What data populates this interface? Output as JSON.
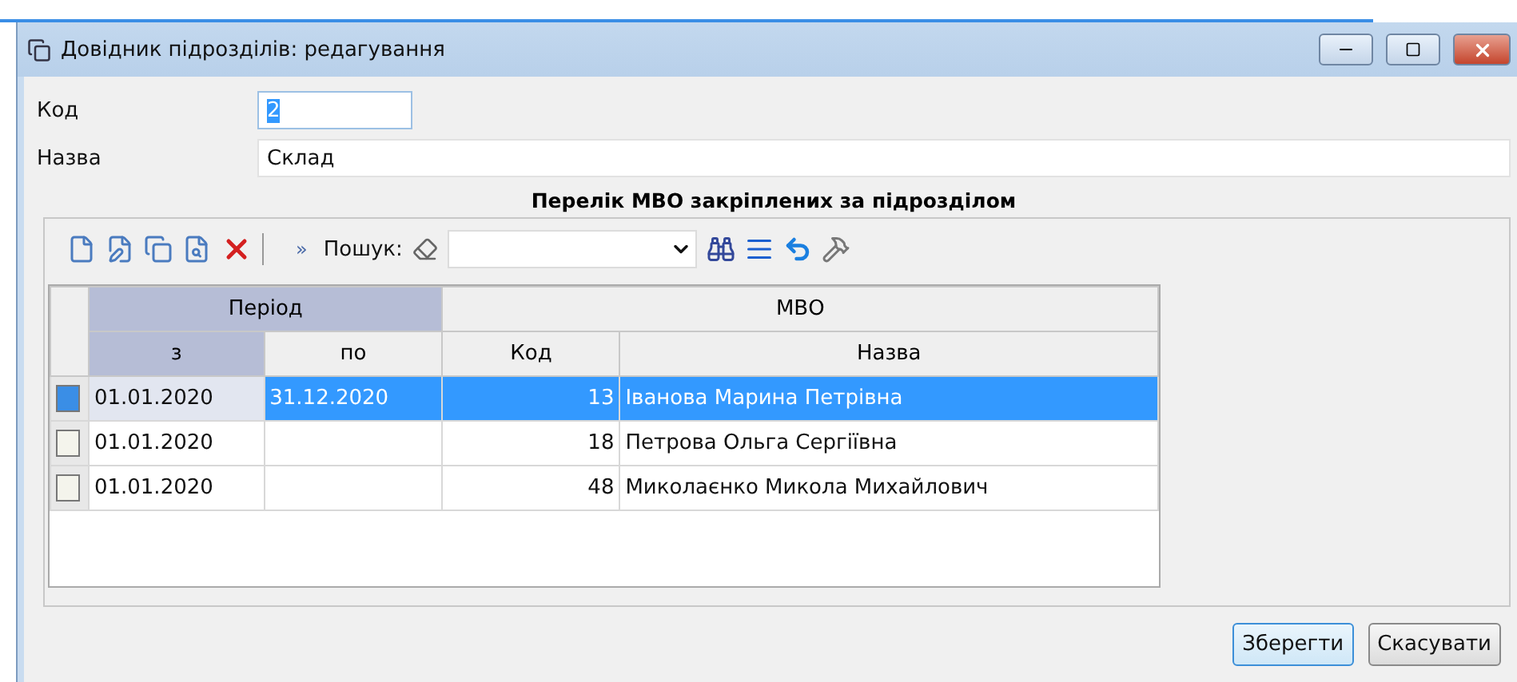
{
  "window": {
    "title": "Довідник підрозділів: редагування"
  },
  "fields": [
    {
      "label": "Код",
      "value": "2",
      "text_selected": true,
      "kind": "short"
    },
    {
      "label": "Назва",
      "value": "Склад",
      "text_selected": false,
      "kind": "wide"
    }
  ],
  "list_title": "Перелік МВО закріплених за підрозділом",
  "toolbar": {
    "more": "»",
    "search_label": "Пошук:"
  },
  "table": {
    "groups": [
      {
        "label": "Період",
        "selected": true
      },
      {
        "label": "МВО",
        "selected": false
      }
    ],
    "columns": [
      {
        "label": "з",
        "selected": true
      },
      {
        "label": "по",
        "selected": false
      },
      {
        "label": "Код",
        "selected": false
      },
      {
        "label": "Назва",
        "selected": false
      }
    ],
    "rows": [
      {
        "cells": [
          "01.01.2020",
          "31.12.2020",
          "13",
          "Іванова Марина Петрівна"
        ],
        "selected": true
      },
      {
        "cells": [
          "01.01.2020",
          "",
          "18",
          "Петрова Ольга Сергіївна"
        ],
        "selected": false
      },
      {
        "cells": [
          "01.01.2020",
          "",
          "48",
          "Миколаєнко Микола Михайлович"
        ],
        "selected": false
      }
    ]
  },
  "buttons": [
    {
      "label": "Зберегти",
      "selected": true
    },
    {
      "label": "Скасувати",
      "selected": false
    }
  ]
}
